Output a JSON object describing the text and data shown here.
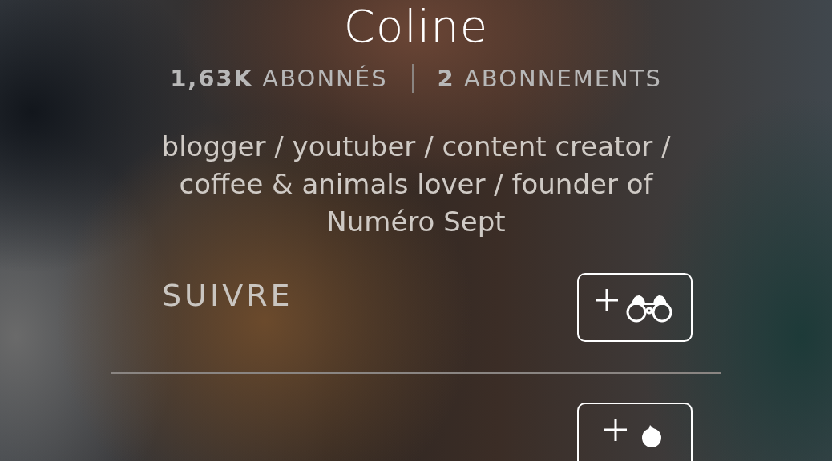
{
  "profile": {
    "name": "Coline"
  },
  "stats": [
    {
      "text": "**1,63K** ABONNÉS"
    },
    {
      "text": "**2** ABONNEMENTS"
    }
  ],
  "bio": "blogger / youtuber / content creator / coffee & animals lover / founder of Numéro Sept",
  "actions": [
    {
      "label": "SUIVRE",
      "kind": "binoculars"
    },
    {
      "kind": "blob"
    }
  ]
}
